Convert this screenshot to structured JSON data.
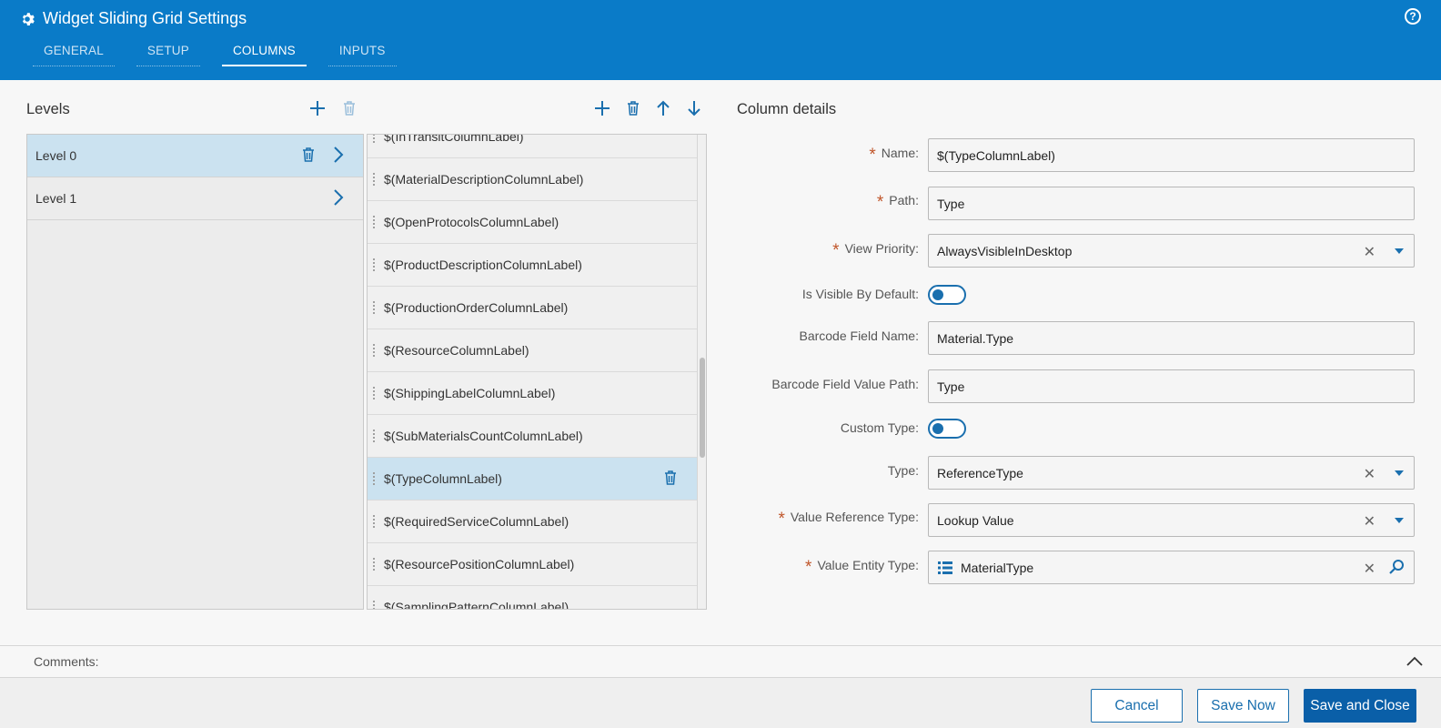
{
  "header": {
    "title": "Widget Sliding Grid Settings",
    "help_glyph": "?",
    "tabs": [
      {
        "label": "GENERAL"
      },
      {
        "label": "SETUP"
      },
      {
        "label": "COLUMNS"
      },
      {
        "label": "INPUTS"
      }
    ],
    "active_tab": "COLUMNS"
  },
  "levels": {
    "title": "Levels",
    "items": [
      {
        "label": "Level 0"
      },
      {
        "label": "Level 1"
      }
    ]
  },
  "columns": {
    "items": [
      {
        "label": "$(InTransitColumnLabel)"
      },
      {
        "label": "$(MaterialDescriptionColumnLabel)"
      },
      {
        "label": "$(OpenProtocolsColumnLabel)"
      },
      {
        "label": "$(ProductDescriptionColumnLabel)"
      },
      {
        "label": "$(ProductionOrderColumnLabel)"
      },
      {
        "label": "$(ResourceColumnLabel)"
      },
      {
        "label": "$(ShippingLabelColumnLabel)"
      },
      {
        "label": "$(SubMaterialsCountColumnLabel)"
      },
      {
        "label": "$(TypeColumnLabel)"
      },
      {
        "label": "$(RequiredServiceColumnLabel)"
      },
      {
        "label": "$(ResourcePositionColumnLabel)"
      },
      {
        "label": "$(SamplingPatternColumnLabel)"
      }
    ]
  },
  "details": {
    "title": "Column details",
    "name_label": "Name:",
    "name_value": "$(TypeColumnLabel)",
    "path_label": "Path:",
    "path_value": "Type",
    "view_priority_label": "View Priority:",
    "view_priority_value": "AlwaysVisibleInDesktop",
    "visible_default_label": "Is Visible By Default:",
    "barcode_name_label": "Barcode Field Name:",
    "barcode_name_value": "Material.Type",
    "barcode_path_label": "Barcode Field Value Path:",
    "barcode_path_value": "Type",
    "custom_type_label": "Custom Type:",
    "type_label": "Type:",
    "type_value": "ReferenceType",
    "value_ref_type_label": "Value Reference Type:",
    "value_ref_type_value": "Lookup Value",
    "value_entity_type_label": "Value Entity Type:",
    "value_entity_type_value": "MaterialType",
    "required_mark": "*"
  },
  "comments": {
    "label": "Comments:"
  },
  "footer": {
    "cancel": "Cancel",
    "save_now": "Save Now",
    "save_close": "Save and Close"
  },
  "colors": {
    "header": "#0a7bc8",
    "accent": "#1a6fae",
    "selected_row": "#cbe2f0",
    "required": "#c0562b"
  }
}
